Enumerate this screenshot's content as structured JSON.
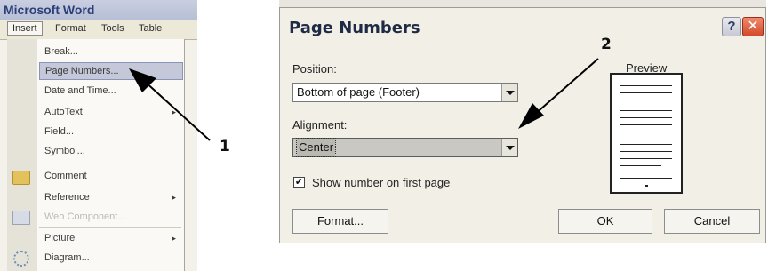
{
  "left": {
    "app_title": "Microsoft Word",
    "menubar": {
      "insert": "Insert",
      "format": "Format",
      "tools": "Tools",
      "table": "Table"
    },
    "menu_items": [
      {
        "label": "Break...",
        "highlighted": false,
        "disabled": false,
        "submenu": false
      },
      {
        "label": "Page Numbers...",
        "highlighted": true,
        "disabled": false,
        "submenu": false
      },
      {
        "label": "Date and Time...",
        "highlighted": false,
        "disabled": false,
        "submenu": false
      },
      {
        "label": "AutoText",
        "highlighted": false,
        "disabled": false,
        "submenu": true
      },
      {
        "label": "Field...",
        "highlighted": false,
        "disabled": false,
        "submenu": false
      },
      {
        "label": "Symbol...",
        "highlighted": false,
        "disabled": false,
        "submenu": false
      },
      {
        "label": "Comment",
        "highlighted": false,
        "disabled": false,
        "submenu": false
      },
      {
        "label": "Reference",
        "highlighted": false,
        "disabled": false,
        "submenu": true
      },
      {
        "label": "Web Component...",
        "highlighted": false,
        "disabled": true,
        "submenu": false
      },
      {
        "label": "Picture",
        "highlighted": false,
        "disabled": false,
        "submenu": true
      },
      {
        "label": "Diagram...",
        "highlighted": false,
        "disabled": false,
        "submenu": false
      }
    ],
    "submenu_arrow": "▸",
    "icons": [
      "folder-icon",
      "web-component-icon",
      "diagram-icon"
    ]
  },
  "dialog": {
    "title": "Page Numbers",
    "help_glyph": "?",
    "close_glyph": "✕",
    "position_label": "Position:",
    "position_value": "Bottom of page (Footer)",
    "alignment_label": "Alignment:",
    "alignment_value": "Center",
    "show_first_page_label": "Show number on first page",
    "show_first_page_checked": true,
    "check_glyph": "✔",
    "preview_label": "Preview",
    "format_button": "Format...",
    "ok_button": "OK",
    "cancel_button": "Cancel"
  },
  "callouts": {
    "one": "1",
    "two": "2"
  }
}
